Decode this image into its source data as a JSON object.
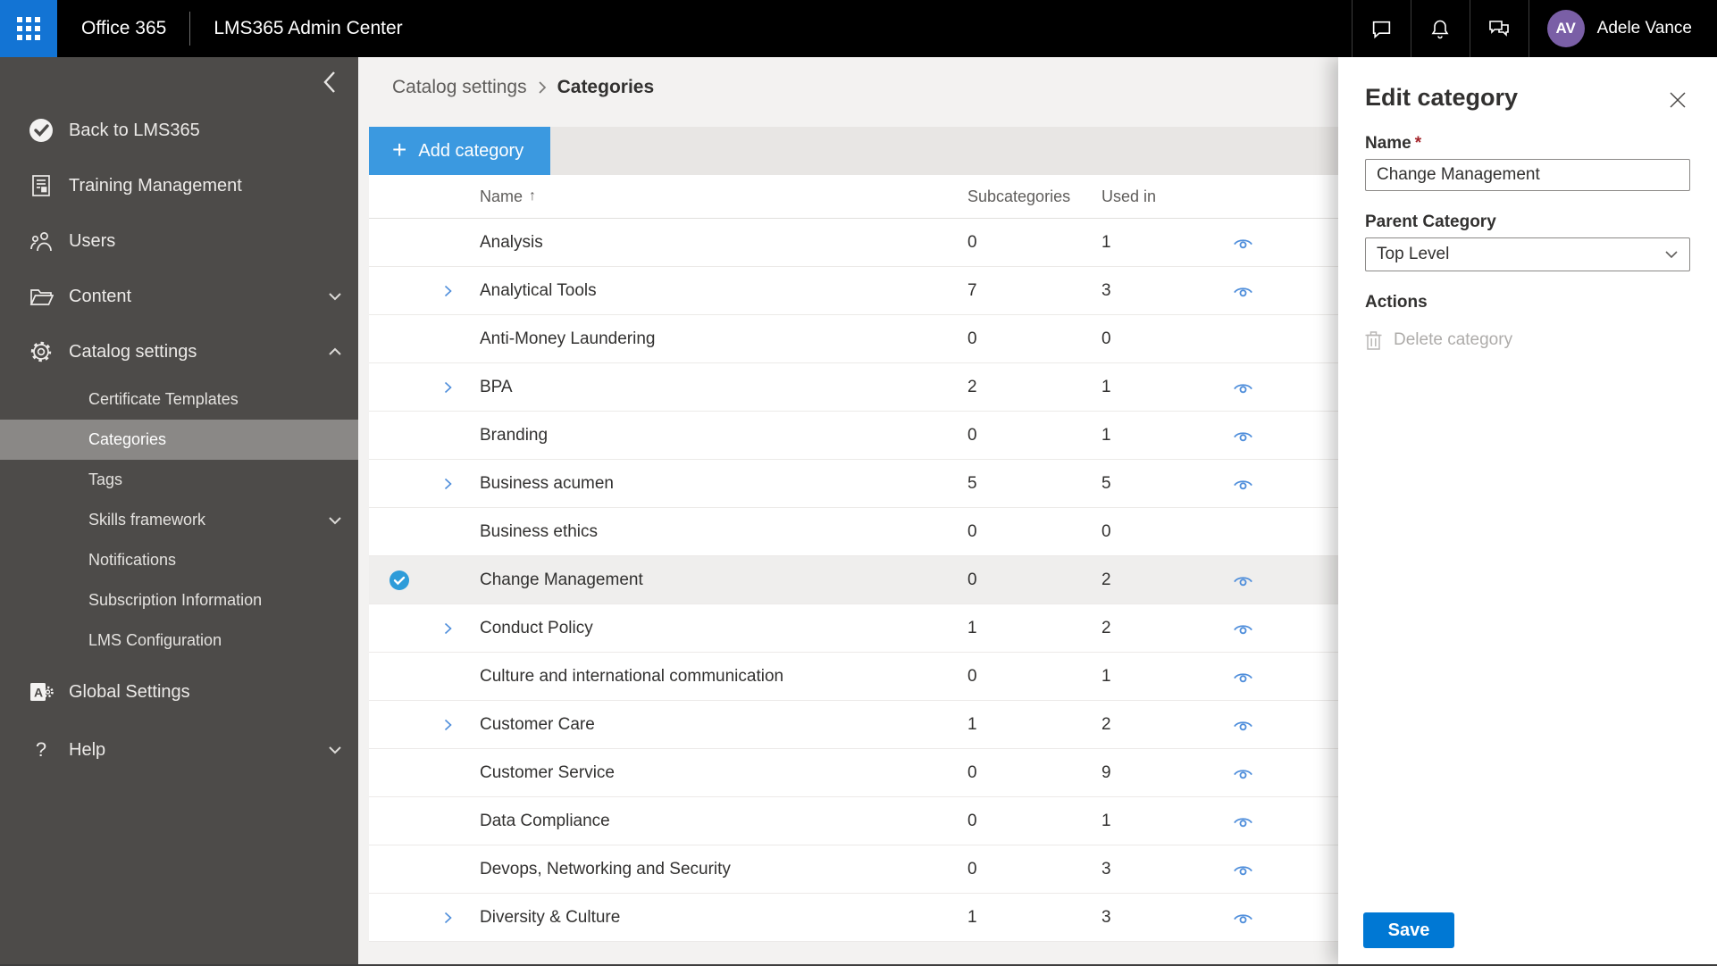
{
  "topbar": {
    "brand": "Office 365",
    "app_title": "LMS365 Admin Center",
    "user_initials": "AV",
    "user_name": "Adele Vance"
  },
  "sidebar": {
    "items": [
      {
        "label": "Back to LMS365"
      },
      {
        "label": "Training Management"
      },
      {
        "label": "Users"
      },
      {
        "label": "Content"
      },
      {
        "label": "Catalog settings"
      },
      {
        "label": "Certificate Templates"
      },
      {
        "label": "Categories"
      },
      {
        "label": "Tags"
      },
      {
        "label": "Skills framework"
      },
      {
        "label": "Notifications"
      },
      {
        "label": "Subscription Information"
      },
      {
        "label": "LMS Configuration"
      },
      {
        "label": "Global Settings"
      },
      {
        "label": "Help"
      }
    ]
  },
  "breadcrumb": {
    "parent": "Catalog settings",
    "current": "Categories"
  },
  "toolbar": {
    "add_label": "Add category"
  },
  "table": {
    "columns": [
      "Name",
      "Subcategories",
      "Used in"
    ],
    "sort_indicator": "↑",
    "rows": [
      {
        "name": "Analysis",
        "expandable": false,
        "subcategories": "0",
        "used_in": "1",
        "eye": true,
        "selected": false
      },
      {
        "name": "Analytical Tools",
        "expandable": true,
        "subcategories": "7",
        "used_in": "3",
        "eye": true,
        "selected": false
      },
      {
        "name": "Anti-Money Laundering",
        "expandable": false,
        "subcategories": "0",
        "used_in": "0",
        "eye": false,
        "selected": false
      },
      {
        "name": "BPA",
        "expandable": true,
        "subcategories": "2",
        "used_in": "1",
        "eye": true,
        "selected": false
      },
      {
        "name": "Branding",
        "expandable": false,
        "subcategories": "0",
        "used_in": "1",
        "eye": true,
        "selected": false
      },
      {
        "name": "Business acumen",
        "expandable": true,
        "subcategories": "5",
        "used_in": "5",
        "eye": true,
        "selected": false
      },
      {
        "name": "Business ethics",
        "expandable": false,
        "subcategories": "0",
        "used_in": "0",
        "eye": false,
        "selected": false
      },
      {
        "name": "Change Management",
        "expandable": false,
        "subcategories": "0",
        "used_in": "2",
        "eye": true,
        "selected": true
      },
      {
        "name": "Conduct Policy",
        "expandable": true,
        "subcategories": "1",
        "used_in": "2",
        "eye": true,
        "selected": false
      },
      {
        "name": "Culture and international communication",
        "expandable": false,
        "subcategories": "0",
        "used_in": "1",
        "eye": true,
        "selected": false
      },
      {
        "name": "Customer Care",
        "expandable": true,
        "subcategories": "1",
        "used_in": "2",
        "eye": true,
        "selected": false
      },
      {
        "name": "Customer Service",
        "expandable": false,
        "subcategories": "0",
        "used_in": "9",
        "eye": true,
        "selected": false
      },
      {
        "name": "Data Compliance",
        "expandable": false,
        "subcategories": "0",
        "used_in": "1",
        "eye": true,
        "selected": false
      },
      {
        "name": "Devops, Networking and Security",
        "expandable": false,
        "subcategories": "0",
        "used_in": "3",
        "eye": true,
        "selected": false
      },
      {
        "name": "Diversity & Culture",
        "expandable": true,
        "subcategories": "1",
        "used_in": "3",
        "eye": true,
        "selected": false
      }
    ]
  },
  "panel": {
    "title": "Edit category",
    "name_label": "Name",
    "required_marker": "*",
    "name_value": "Change Management",
    "parent_label": "Parent Category",
    "parent_value": "Top Level",
    "actions_label": "Actions",
    "delete_label": "Delete category",
    "save_label": "Save"
  },
  "colors": {
    "topbar_bg": "#000000",
    "waffle_bg": "#1374d4",
    "sidebar_bg": "#4d4b49",
    "sidebar_selected_bg": "#8a8886",
    "avatar_bg": "#7a5fa6",
    "add_button_bg": "#3b99e0",
    "save_button_bg": "#0078d4",
    "selected_check_bg": "#2e9cd9",
    "eye_icon": "#4f8edb",
    "required_marker": "#a4262c",
    "main_bg": "#f3f2f1",
    "toolbar_strip_bg": "#e8e6e4"
  }
}
